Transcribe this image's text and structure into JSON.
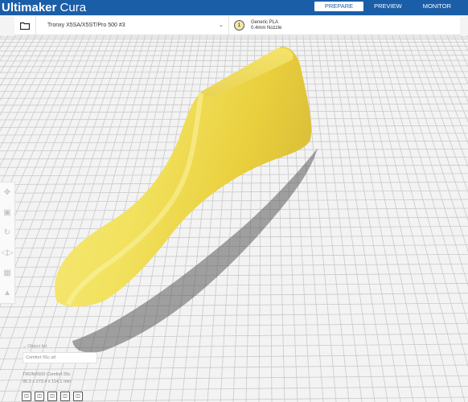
{
  "app": {
    "brand_bold": "Ultimaker",
    "brand_rest": "Cura"
  },
  "stages": [
    {
      "label": "PREPARE",
      "active": true
    },
    {
      "label": "PREVIEW",
      "active": false
    },
    {
      "label": "MONITOR",
      "active": false
    }
  ],
  "toolbar": {
    "open_icon": "folder-icon",
    "printer": "Tronxy X5SA/X5ST/Pro 500 #3",
    "extruder_number": "1",
    "material": "Generic PLA",
    "nozzle": "0.4mm Nozzle"
  },
  "tools": [
    {
      "name": "move-tool",
      "icon": "move-icon"
    },
    {
      "name": "scale-tool",
      "icon": "scale-icon"
    },
    {
      "name": "rotate-tool",
      "icon": "rotate-icon"
    },
    {
      "name": "mirror-tool",
      "icon": "mirror-icon"
    },
    {
      "name": "per-model-settings-tool",
      "icon": "per-model-settings-icon"
    },
    {
      "name": "support-blocker-tool",
      "icon": "support-blocker-icon"
    }
  ],
  "object_list": {
    "header": "Object list",
    "file": "Comfort 55c.stl",
    "object_name": "TRONX500 Comfort 55c",
    "dimensions": "95.3 x 273.4 x 114.1 mm"
  },
  "view_buttons": [
    "3D",
    "F",
    "T",
    "L",
    "R"
  ],
  "colors": {
    "model": "#f2e36b",
    "accent": "#1b5ea8",
    "grid": "#c9c9c9"
  }
}
